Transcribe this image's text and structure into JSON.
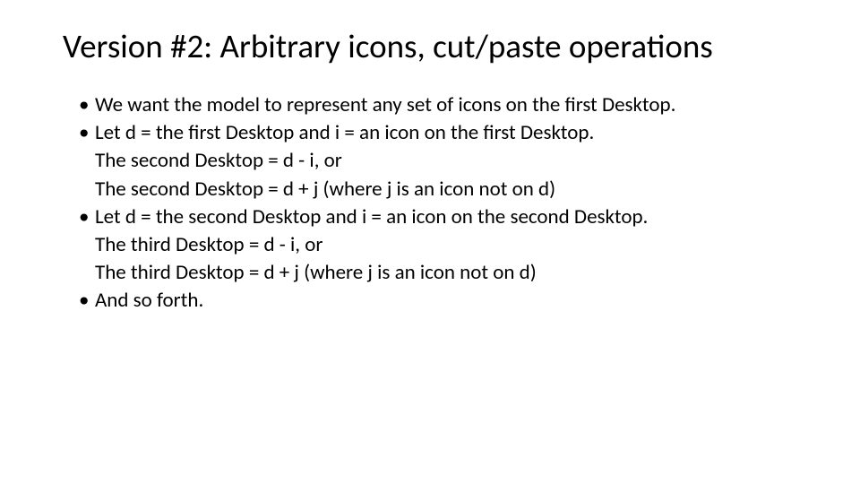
{
  "title": "Version #2: Arbitrary icons, cut/paste operations",
  "bullets": [
    {
      "lines": [
        "We want the model to represent any set of icons on the first Desktop."
      ]
    },
    {
      "lines": [
        "Let d = the first Desktop and i = an icon on the first Desktop.",
        "The second Desktop = d - i, or",
        "The second Desktop = d + j (where j is an icon not on d)"
      ]
    },
    {
      "lines": [
        "Let d = the second Desktop and i = an icon on the second Desktop.",
        "The third Desktop = d - i, or",
        "The third Desktop = d + j (where j is an icon not on d)"
      ]
    },
    {
      "lines": [
        "And so forth."
      ]
    }
  ]
}
